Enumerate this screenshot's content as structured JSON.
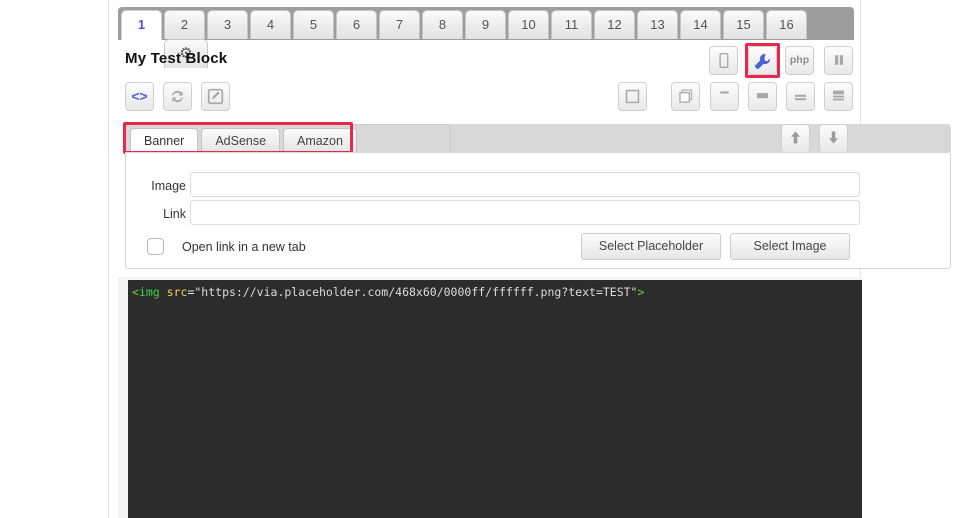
{
  "tabs": {
    "items": [
      {
        "label": "1",
        "active": true
      },
      {
        "label": "2",
        "active": false
      },
      {
        "label": "3",
        "active": false
      },
      {
        "label": "4",
        "active": false
      },
      {
        "label": "5",
        "active": false
      },
      {
        "label": "6",
        "active": false
      },
      {
        "label": "7",
        "active": false
      },
      {
        "label": "8",
        "active": false
      },
      {
        "label": "9",
        "active": false
      },
      {
        "label": "10",
        "active": false
      },
      {
        "label": "11",
        "active": false
      },
      {
        "label": "12",
        "active": false
      },
      {
        "label": "13",
        "active": false
      },
      {
        "label": "14",
        "active": false
      },
      {
        "label": "15",
        "active": false
      },
      {
        "label": "16",
        "active": false
      }
    ],
    "settings_icon": "gear-icon",
    "settings_glyph": "⚙"
  },
  "header": {
    "title": "My Test Block"
  },
  "left_toolbar": [
    {
      "name": "code-view-button",
      "icon": "code-brackets-icon",
      "glyph": "<>",
      "accent": true
    },
    {
      "name": "refresh-button",
      "icon": "refresh-icon",
      "glyph": "",
      "accent": false
    },
    {
      "name": "edit-button",
      "icon": "pencil-square-icon",
      "glyph": "",
      "accent": false
    }
  ],
  "right_toolbar_top": [
    {
      "name": "mobile-preview-button",
      "icon": "mobile-device-icon",
      "label": ""
    },
    {
      "name": "settings-wrench-button",
      "icon": "wrench-icon",
      "label": "",
      "highlighted": true
    },
    {
      "name": "php-button",
      "icon": "php-icon",
      "label": "php"
    },
    {
      "name": "pause-button",
      "icon": "pause-icon",
      "label": ""
    }
  ],
  "right_toolbar_bottom": [
    {
      "name": "layout-single-button",
      "icon": "square-outline-icon"
    },
    {
      "name": "layout-stacked-button",
      "icon": "stacked-squares-icon"
    },
    {
      "name": "layout-top-bar-button",
      "icon": "small-bar-icon"
    },
    {
      "name": "layout-filled-bar-button",
      "icon": "filled-bar-icon"
    },
    {
      "name": "layout-two-lines-button",
      "icon": "two-lines-icon"
    },
    {
      "name": "layout-block-lines-button",
      "icon": "block-lines-icon"
    }
  ],
  "subtabs": {
    "items": [
      {
        "label": "Banner",
        "active": true
      },
      {
        "label": "AdSense",
        "active": false
      },
      {
        "label": "Amazon",
        "active": false
      }
    ],
    "highlighted": true,
    "move_up": {
      "name": "move-up-button",
      "icon": "arrow-up-icon"
    },
    "move_down": {
      "name": "move-down-button",
      "icon": "arrow-down-icon"
    }
  },
  "form": {
    "image_label": "Image",
    "image_value": "",
    "image_placeholder": "",
    "link_label": "Link",
    "link_value": "",
    "link_placeholder": "",
    "checkbox_label": "Open link in a new tab",
    "checkbox_checked": false,
    "select_placeholder_button": "Select Placeholder",
    "select_image_button": "Select Image"
  },
  "editor": {
    "code_tokens": [
      {
        "t": "<",
        "c": "tk-punc"
      },
      {
        "t": "img",
        "c": "tk-tag"
      },
      {
        "t": " ",
        "c": "tk-str"
      },
      {
        "t": "src",
        "c": "tk-attr"
      },
      {
        "t": "=",
        "c": "tk-eq"
      },
      {
        "t": "\"https://via.placeholder.com/468x60/0000ff/ffffff.png?text=TEST\"",
        "c": "tk-str"
      },
      {
        "t": ">",
        "c": "tk-punc"
      }
    ],
    "code_text": "<img src=\"https://via.placeholder.com/468x60/0000ff/ffffff.png?text=TEST\">"
  },
  "colors": {
    "accent_blue": "#4a62d6",
    "highlight_red": "#e8274e",
    "editor_bg": "#2c2c2c",
    "tabstrip_bg": "#9d9d9d"
  }
}
